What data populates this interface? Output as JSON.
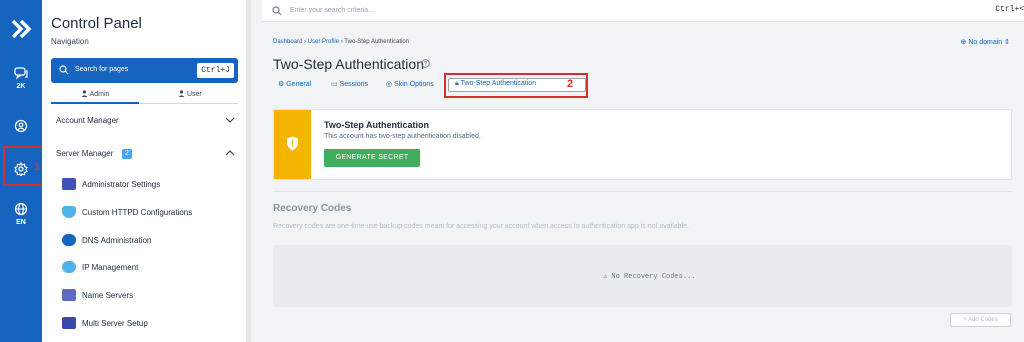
{
  "rail": {
    "items": [
      {
        "icon": "arrow-logo-icon"
      },
      {
        "icon": "chat-icon",
        "label": "2K"
      },
      {
        "icon": "user-circle-icon"
      },
      {
        "icon": "gear-icon",
        "marker": "1"
      },
      {
        "icon": "globe-icon",
        "label": "EN"
      }
    ]
  },
  "nav": {
    "title": "Control Panel",
    "subtitle": "Navigation",
    "search_placeholder": "Search for pages",
    "search_shortcut": "Ctrl+J",
    "tabs": {
      "admin": "Admin",
      "user": "User"
    },
    "account_manager": "Account Manager",
    "server_manager": "Server Manager",
    "server_manager_badge": "2",
    "items": [
      {
        "label": "Administrator Settings",
        "icon": "admin-settings-icon"
      },
      {
        "label": "Custom HTTPD Configurations",
        "icon": "shield-icon"
      },
      {
        "label": "DNS Administration",
        "icon": "dns-icon"
      },
      {
        "label": "IP Management",
        "icon": "network-icon"
      },
      {
        "label": "Name Servers",
        "icon": "server-stack-icon"
      },
      {
        "label": "Multi Server Setup",
        "icon": "multi-server-icon"
      }
    ]
  },
  "topbar": {
    "search_placeholder": "Enter your search criteria...",
    "shortcut": "Ctrl+<"
  },
  "breadcrumb": {
    "dashboard": "Dashboard",
    "profile": "User Profile",
    "current": "Two-Step Authentication"
  },
  "domain_selector": "No domain",
  "page": {
    "title": "Two-Step Authentication",
    "tabs": {
      "general": "General",
      "sessions": "Sessions",
      "skin": "Skin Options",
      "twostep": "Two-Step Authentication"
    },
    "marker": "2"
  },
  "tsa_card": {
    "title": "Two-Step Authentication",
    "description": "This account has two-step authentication disabled.",
    "button": "GENERATE SECRET"
  },
  "recovery": {
    "title": "Recovery Codes",
    "description": "Recovery codes are one-time use backup codes meant for accessing your account when access to authentication app is not available.",
    "empty": "No Recovery Codes...",
    "add_button": "Add Codes"
  },
  "colors": {
    "primary": "#1565c0",
    "warning": "#f4b400",
    "success": "#3fae5d",
    "annotation": "#d32f2f"
  }
}
